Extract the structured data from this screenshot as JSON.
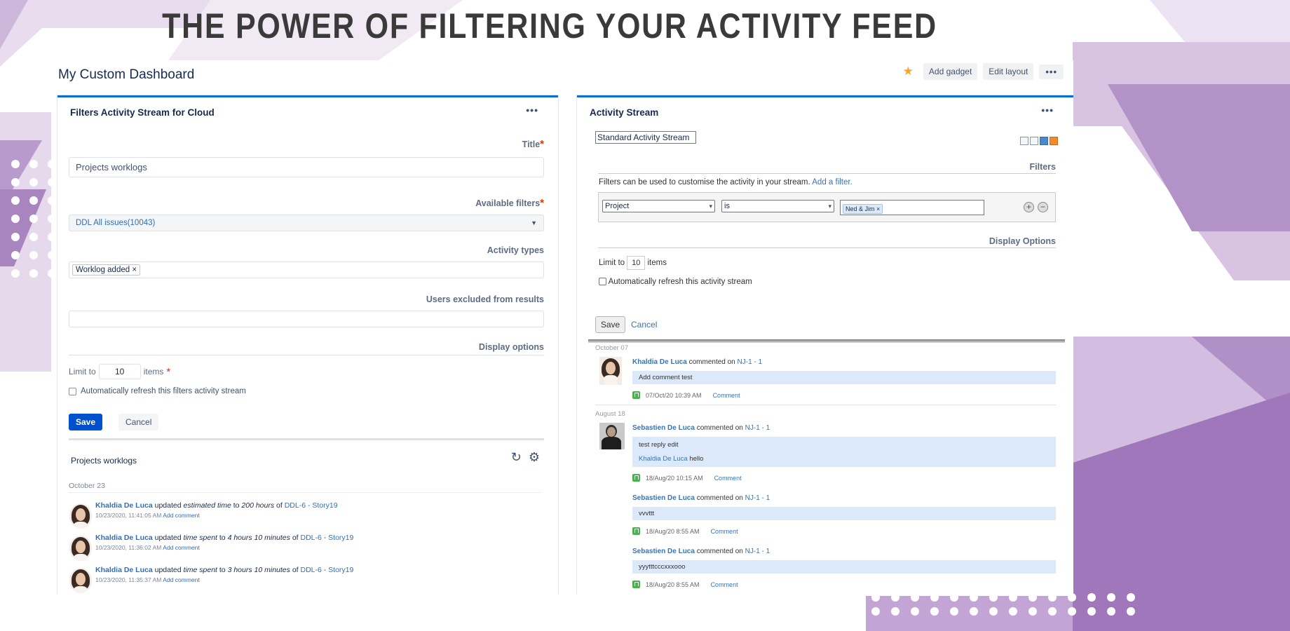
{
  "headline": "THE POWER OF FILTERING YOUR ACTIVITY FEED",
  "dashboard": {
    "title": "My Custom Dashboard",
    "star_icon": "star-icon",
    "add_gadget_label": "Add gadget",
    "edit_layout_label": "Edit layout",
    "more_label": "•••"
  },
  "left_gadget": {
    "title": "Filters Activity Stream for Cloud",
    "menu_label": "•••",
    "required_mark": "*",
    "title_field": {
      "label": "Title",
      "value": "Projects worklogs"
    },
    "available_filters": {
      "label": "Available filters",
      "value": "DDL All issues(10043)"
    },
    "activity_types": {
      "label": "Activity types",
      "chip": "Worklog added",
      "chip_remove": "×"
    },
    "users_excluded": {
      "label": "Users excluded from results",
      "value": ""
    },
    "display_options_label": "Display options",
    "limit": {
      "prefix": "Limit to",
      "value": "10",
      "suffix": "items"
    },
    "auto_refresh_label": "Automatically refresh this filters activity stream",
    "save_label": "Save",
    "cancel_label": "Cancel",
    "feed": {
      "title": "Projects worklogs",
      "date": "October 23",
      "entries": [
        {
          "user": "Khaldia De Luca",
          "verb": "updated",
          "field": "estimated time",
          "to": "to",
          "amount": "200 hours",
          "of": "of",
          "issue": "DDL-6 - Story19",
          "meta": "10/23/2020, 11:41:05 AM",
          "action": "Add comment"
        },
        {
          "user": "Khaldia De Luca",
          "verb": "updated",
          "field": "time spent",
          "to": "to",
          "amount": "4 hours 10 minutes",
          "of": "of",
          "issue": "DDL-6 - Story19",
          "meta": "10/23/2020, 11:36:02 AM",
          "action": "Add comment"
        },
        {
          "user": "Khaldia De Luca",
          "verb": "updated",
          "field": "time spent",
          "to": "to",
          "amount": "3 hours 10 minutes",
          "of": "of",
          "issue": "DDL-6 - Story19",
          "meta": "10/23/2020, 11:35:37 AM",
          "action": "Add comment"
        }
      ]
    }
  },
  "right_gadget": {
    "title": "Activity Stream",
    "menu_label": "•••",
    "stream_title": "Standard Activity Stream",
    "filters_label": "Filters",
    "filters_help": "Filters can be used to customise the activity in your stream.",
    "add_filter_label": "Add a filter.",
    "filter_row": {
      "field": "Project",
      "operator": "is",
      "tag": "Ned & Jim",
      "tag_remove": "×",
      "add_icon": "+",
      "remove_icon": "−"
    },
    "display_options_label": "Display Options",
    "limit": {
      "prefix": "Limit to",
      "value": "10",
      "suffix": "items"
    },
    "auto_refresh_label": "Automatically refresh this activity stream",
    "save_label": "Save",
    "cancel_label": "Cancel",
    "stream": {
      "date1": "October 07",
      "e1": {
        "user": "Khaldia De Luca",
        "verb": "commented on",
        "issue": "NJ-1 - 1",
        "comment": "Add comment test",
        "meta": "07/Oct/20 10:39 AM",
        "action": "Comment"
      },
      "date2": "August 18",
      "e2": {
        "user": "Sebastien De Luca",
        "verb": "commented on",
        "issue": "NJ-1 - 1",
        "comment": "test reply edit",
        "reply_user": "Khaldia De Luca",
        "reply_text": "hello",
        "meta": "18/Aug/20 10:15 AM",
        "action": "Comment"
      },
      "e3": {
        "user": "Sebastien De Luca",
        "verb": "commented on",
        "issue": "NJ-1 - 1",
        "comment": "vvvttt",
        "meta": "18/Aug/20 8:55 AM",
        "action": "Comment"
      },
      "e4": {
        "user": "Sebastien De Luca",
        "verb": "commented on",
        "issue": "NJ-1 - 1",
        "comment": "yyytttcccxxxooo",
        "meta": "18/Aug/20 8:55 AM",
        "action": "Comment"
      }
    }
  }
}
